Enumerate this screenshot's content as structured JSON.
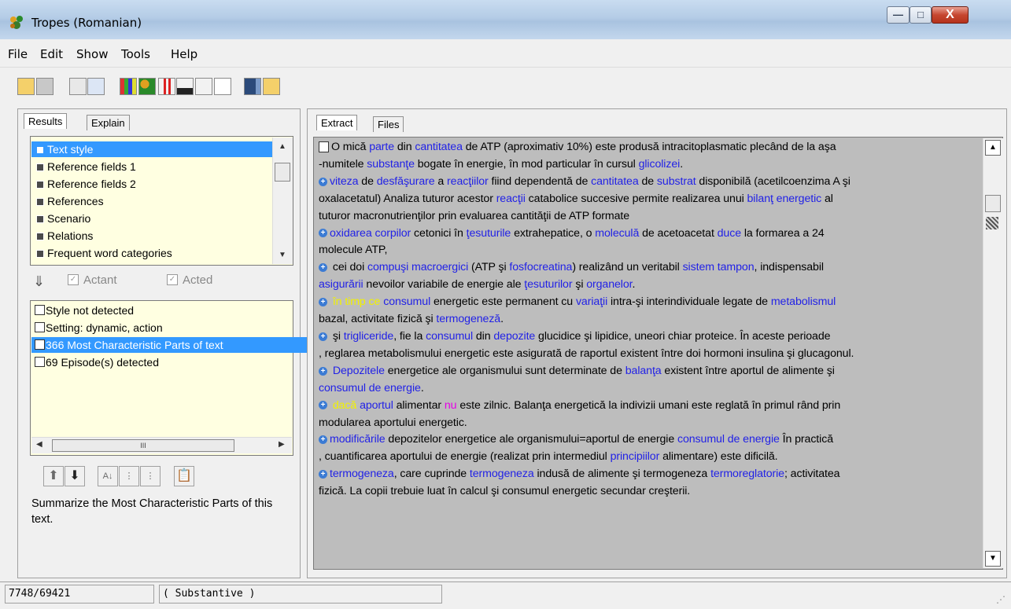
{
  "window": {
    "title": "Tropes (Romanian)",
    "minimize_label": "—",
    "maximize_label": "□",
    "close_label": "X"
  },
  "menu": [
    "File",
    "Edit",
    "Show",
    "Tools",
    "Help"
  ],
  "left_panel": {
    "tabs": [
      "Results",
      "Explain"
    ],
    "categories": [
      "Text style",
      "Reference fields 1",
      "Reference fields 2",
      "References",
      "Scenario",
      "Relations",
      "Frequent word categories"
    ],
    "selected_category": 0,
    "actant_label": "Actant",
    "acted_label": "Acted",
    "results": [
      "Style not detected",
      "Setting: dynamic, action",
      "366 Most Characteristic Parts of text",
      "69 Episode(s) detected"
    ],
    "selected_result": 2,
    "hscroll_thumb_label": "III",
    "description": "Summarize the Most Characteristic Parts of this text."
  },
  "right_panel": {
    "tabs": [
      "Extract",
      "Files"
    ],
    "lines": [
      {
        "icon": "doc",
        "segs": [
          [
            "k",
            "O mică "
          ],
          [
            "b",
            "parte"
          ],
          [
            "k",
            " din "
          ],
          [
            "b",
            "cantitatea"
          ],
          [
            "k",
            " de ATP (aproximativ 10%) este produsă intracitoplasmatic plecând de la aşa"
          ]
        ]
      },
      {
        "segs": [
          [
            "k",
            "-numitele "
          ],
          [
            "b",
            "substanţe"
          ],
          [
            "k",
            " bogate în energie, în mod particular în cursul "
          ],
          [
            "b",
            "glicolizei"
          ],
          [
            "k",
            "."
          ]
        ]
      },
      {
        "icon": "plus",
        "segs": [
          [
            "b",
            "viteza"
          ],
          [
            "k",
            " de "
          ],
          [
            "b",
            "desfăşurare"
          ],
          [
            "k",
            " a "
          ],
          [
            "b",
            "reacţiilor"
          ],
          [
            "k",
            " fiind dependentă de "
          ],
          [
            "b",
            "cantitatea"
          ],
          [
            "k",
            " de "
          ],
          [
            "b",
            "substrat"
          ],
          [
            "k",
            " disponibilă (acetilcoenzima A şi"
          ]
        ]
      },
      {
        "segs": [
          [
            "k",
            "oxalacetatul)  Analiza tuturor acestor "
          ],
          [
            "b",
            "reacţii"
          ],
          [
            "k",
            " catabolice succesive permite realizarea unui "
          ],
          [
            "b",
            "bilanţ energetic"
          ],
          [
            "k",
            " al"
          ]
        ]
      },
      {
        "segs": [
          [
            "k",
            "tuturor macronutrienţilor prin evaluarea cantităţii de ATP formate"
          ]
        ]
      },
      {
        "icon": "plus",
        "segs": [
          [
            "b",
            "oxidarea corpilor"
          ],
          [
            "k",
            " cetonici în "
          ],
          [
            "b",
            "ţesuturile"
          ],
          [
            "k",
            " extrahepatice, o "
          ],
          [
            "b",
            "moleculă"
          ],
          [
            "k",
            " de acetoacetat "
          ],
          [
            "b",
            "duce"
          ],
          [
            "k",
            " la formarea a 24"
          ]
        ]
      },
      {
        "segs": [
          [
            "k",
            "molecule ATP,"
          ]
        ]
      },
      {
        "icon": "plus",
        "segs": [
          [
            "k",
            " cei doi "
          ],
          [
            "b",
            "compuşi macroergici"
          ],
          [
            "k",
            " (ATP şi "
          ],
          [
            "b",
            "fosfocreatina"
          ],
          [
            "k",
            ") realizând un veritabil "
          ],
          [
            "b",
            "sistem tampon"
          ],
          [
            "k",
            ", indispensabil"
          ]
        ]
      },
      {
        "segs": [
          [
            "b",
            "asigurării"
          ],
          [
            "k",
            " nevoilor variabile de energie ale "
          ],
          [
            "b",
            "ţesuturilor"
          ],
          [
            "k",
            " şi "
          ],
          [
            "b",
            "organelor"
          ],
          [
            "k",
            "."
          ]
        ]
      },
      {
        "icon": "plus",
        "segs": [
          [
            "y",
            " în timp ce"
          ],
          [
            "k",
            " "
          ],
          [
            "b",
            "consumul"
          ],
          [
            "k",
            " energetic este permanent cu "
          ],
          [
            "b",
            "variaţii"
          ],
          [
            "k",
            " intra-şi interindividuale legate de "
          ],
          [
            "b",
            "metabolismul"
          ]
        ]
      },
      {
        "segs": [
          [
            "k",
            "bazal, activitate fizică şi "
          ],
          [
            "b",
            "termogeneză"
          ],
          [
            "k",
            "."
          ]
        ]
      },
      {
        "icon": "plus",
        "segs": [
          [
            "k",
            " şi "
          ],
          [
            "b",
            "trigliceride"
          ],
          [
            "k",
            ", fie la "
          ],
          [
            "b",
            "consumul"
          ],
          [
            "k",
            " din "
          ],
          [
            "b",
            "depozite"
          ],
          [
            "k",
            " glucidice şi lipidice, uneori chiar proteice. În aceste perioade"
          ]
        ]
      },
      {
        "segs": [
          [
            "k",
            ", reglarea metabolismului energetic este asigurată de raportul existent între doi hormoni insulina şi glucagonul."
          ]
        ]
      },
      {
        "icon": "plus",
        "segs": [
          [
            "k",
            " "
          ],
          [
            "b",
            "Depozitele"
          ],
          [
            "k",
            " energetice ale organismului sunt determinate de "
          ],
          [
            "b",
            "balanţa"
          ],
          [
            "k",
            " existent între aportul de alimente şi"
          ]
        ]
      },
      {
        "segs": [
          [
            "b",
            "consumul de energie"
          ],
          [
            "k",
            "."
          ]
        ]
      },
      {
        "icon": "plus",
        "segs": [
          [
            "y",
            " dacă"
          ],
          [
            "k",
            " "
          ],
          [
            "b",
            "aportul"
          ],
          [
            "k",
            " alimentar "
          ],
          [
            "m",
            "nu"
          ],
          [
            "k",
            " este zilnic. Balanţa energetică la indivizii umani este reglată în primul rând prin"
          ]
        ]
      },
      {
        "segs": [
          [
            "k",
            "modularea aportului energetic."
          ]
        ]
      },
      {
        "icon": "plus",
        "segs": [
          [
            "b",
            "modificările"
          ],
          [
            "k",
            " depozitelor energetice ale organismului=aportul de energie "
          ],
          [
            "b",
            "consumul de energie"
          ],
          [
            "k",
            " În practică"
          ]
        ]
      },
      {
        "segs": [
          [
            "k",
            ", cuantificarea aportului de energie (realizat prin intermediul "
          ],
          [
            "b",
            "principiilor"
          ],
          [
            "k",
            " alimentare) este dificilă."
          ]
        ]
      },
      {
        "icon": "plus",
        "segs": [
          [
            "b",
            "termogeneza"
          ],
          [
            "k",
            ", care cuprinde "
          ],
          [
            "b",
            "termogeneza"
          ],
          [
            "k",
            " indusă de alimente şi termogeneza "
          ],
          [
            "b",
            "termoreglatorie"
          ],
          [
            "k",
            "; activitatea"
          ]
        ]
      },
      {
        "segs": [
          [
            "k",
            "fizică. La copii trebuie luat în calcul şi consumul energetic secundar creşterii."
          ]
        ]
      }
    ]
  },
  "status": {
    "position": "7748/69421",
    "mode": "( Substantive )"
  },
  "colors": {
    "link": "#2222e6",
    "highlight_yellow": "#f2f200",
    "highlight_magenta": "#e600e6",
    "selection": "#3399ff",
    "list_bg": "#ffffe1",
    "extract_bg": "#bdbdbd"
  }
}
